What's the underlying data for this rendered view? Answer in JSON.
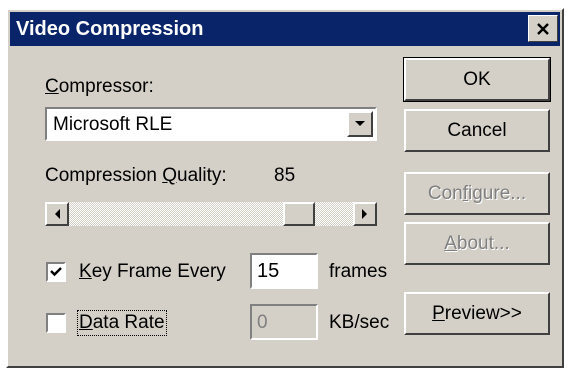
{
  "window": {
    "title": "Video Compression"
  },
  "compressor": {
    "label_mnemonic": "C",
    "label_rest": "ompressor:",
    "selected": "Microsoft RLE"
  },
  "quality": {
    "label_before": "Compression ",
    "label_mnemonic": "Q",
    "label_after": "uality:",
    "value_text": "85",
    "value": 85,
    "max": 100
  },
  "key_frame": {
    "checked": true,
    "label_mnemonic": "K",
    "label_rest": "ey Frame Every",
    "value": "15",
    "units": "frames"
  },
  "data_rate": {
    "checked": false,
    "label_mnemonic": "D",
    "label_rest": "ata Rate",
    "value": "0",
    "units": "KB/sec"
  },
  "buttons": {
    "ok": "OK",
    "cancel": "Cancel",
    "configure_before": "Con",
    "configure_mnemonic": "f",
    "configure_after": "igure...",
    "about_mnemonic": "A",
    "about_after": "bout...",
    "preview_mnemonic": "P",
    "preview_after": "review>>"
  }
}
